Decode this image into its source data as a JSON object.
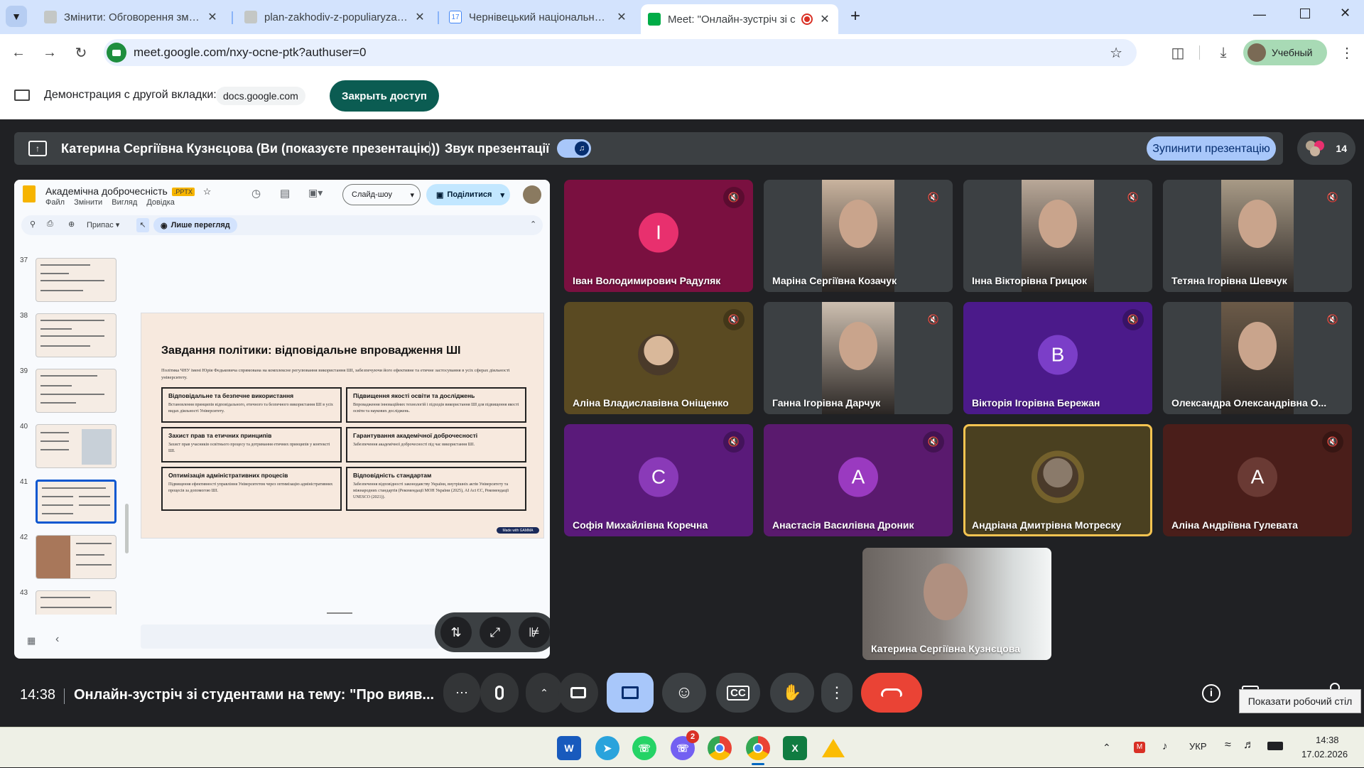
{
  "tabs": [
    {
      "title": "Змінити: Обговорення змін до",
      "active": false
    },
    {
      "title": "plan-zakhodiv-z-populiaryzatsii",
      "active": false
    },
    {
      "title": "Чернівецький національний у",
      "active": false
    },
    {
      "title": "Meet: \"Онлайн-зустріч зі с",
      "active": true
    }
  ],
  "browser": {
    "url": "meet.google.com/nxy-ocne-ptk?authuser=0",
    "profile_label": "Учебный"
  },
  "share_bar": {
    "label": "Демонстрация с другой вкладки:",
    "domain": "docs.google.com",
    "close_button": "Закрыть доступ"
  },
  "presenting_bar": {
    "text": "Катерина Сергіївна Кузнєцова (Ви (показуєте презентацію))",
    "sound_label": "Звук презентації",
    "stop_button": "Зупинити презентацію",
    "participant_count": "14"
  },
  "slides_app": {
    "doc_title": "Академічна доброчесність",
    "badge": ".PPTX",
    "menu": [
      "Файл",
      "Змінити",
      "Вигляд",
      "Довідка"
    ],
    "slideshow_button": "Слайд-шоу",
    "share_button": "Поділитися",
    "zoom_label": "Припас",
    "view_mode": "Лише перегляд",
    "thumbnails": [
      {
        "num": "37",
        "selected": false
      },
      {
        "num": "38",
        "selected": false
      },
      {
        "num": "39",
        "selected": false
      },
      {
        "num": "40",
        "selected": false
      },
      {
        "num": "41",
        "selected": true
      },
      {
        "num": "42",
        "selected": false
      },
      {
        "num": "43",
        "selected": false
      }
    ],
    "slide": {
      "title": "Завдання політики: відповідальне впровадження ШІ",
      "intro": "Політика ЧНУ імені Юрія Федьковича спрямована на комплексне регулювання використання ШІ, забезпечуючи його ефективне та етичне застосування в усіх сферах діяльності університету.",
      "cards": [
        {
          "title": "Відповідальне та безпечне використання",
          "body": "Встановлення принципів відповідального, етичного та безпечного використання ШІ в усіх видах діяльності Університету."
        },
        {
          "title": "Підвищення якості освіти та досліджень",
          "body": "Впровадження інноваційних технологій і підходів використання ШІ для підвищення якості освіти та наукових досліджень."
        },
        {
          "title": "Захист прав та етичних принципів",
          "body": "Захист прав учасників освітнього процесу та дотримання етичних принципів у контексті ШІ."
        },
        {
          "title": "Гарантування академічної доброчесності",
          "body": "Забезпечення академічної доброчесності під час використання ШІ."
        },
        {
          "title": "Оптимізація адміністративних процесів",
          "body": "Підвищення ефективності управління Університетом через оптимізацію адміністративних процесів за допомогою ШІ."
        },
        {
          "title": "Відповідність стандартам",
          "body": "Забезпечення відповідності законодавству України, внутрішніх актів Університету та міжнародних стандартів (Рекомендації МОН України (2025), AI Act ЄС, Рекомендації UNESCO (2021))."
        }
      ],
      "badge": "Made with GAMMA"
    }
  },
  "participants": [
    {
      "name": "Іван Володимирович Радуляк",
      "type": "letter",
      "letter": "І",
      "bg": "#7a1040",
      "circle": "#e8306e",
      "muted": true,
      "video": ""
    },
    {
      "name": "Маріна Сергіївна Козачук",
      "type": "video",
      "bg": "#3c4043",
      "muted": true,
      "video": "#c9b39e"
    },
    {
      "name": "Інна Вікторівна Грицюк",
      "type": "video",
      "bg": "#3c4043",
      "muted": true,
      "video": "#b9a898"
    },
    {
      "name": "Тетяна Ігорівна Шевчук",
      "type": "video",
      "bg": "#3c4043",
      "muted": true,
      "video": "#a89a86"
    },
    {
      "name": "Аліна Владиславівна Оніщенко",
      "type": "avatar",
      "bg": "#5a4a22",
      "muted": true,
      "video": "#d9b89a"
    },
    {
      "name": "Ганна Ігорівна Дарчук",
      "type": "video",
      "bg": "#3c4043",
      "muted": true,
      "video": "#cdbfb0"
    },
    {
      "name": "Вікторія Ігорівна Бережан",
      "type": "letter",
      "letter": "В",
      "bg": "#4b1a8a",
      "circle": "#7b3ec8",
      "muted": true,
      "video": ""
    },
    {
      "name": "Олександра Олександрівна О...",
      "type": "video",
      "bg": "#3c4043",
      "muted": true,
      "video": "#6b5a48"
    },
    {
      "name": "Софія Михайлівна Коречна",
      "type": "letter",
      "letter": "С",
      "bg": "#5a1a7a",
      "circle": "#8a3ab8",
      "muted": true,
      "video": ""
    },
    {
      "name": "Анастасія Василівна Дроник",
      "type": "letter",
      "letter": "А",
      "bg": "#5a1a6e",
      "circle": "#9a3ac0",
      "muted": true,
      "video": ""
    },
    {
      "name": "Андріана Дмитрівна Мотреску",
      "type": "avatar",
      "bg": "#4a4020",
      "muted": false,
      "speaking": true,
      "video": "#8a7a6a"
    },
    {
      "name": "Аліна Андріївна Гулевата",
      "type": "letter",
      "letter": "А",
      "bg": "#4a1e1a",
      "circle": "#6a3a34",
      "muted": true,
      "video": ""
    }
  ],
  "self_tile": {
    "name": "Катерина Сергіївна Кузнєцова"
  },
  "bottom_bar": {
    "time": "14:38",
    "meeting_title": "Онлайн-зустріч зі студентами на тему: \"Про вияв...",
    "tooltip": "Показати робочий стіл"
  },
  "taskbar": {
    "viber_badge": "2",
    "language": "УКР",
    "time": "14:38",
    "date": "17.02.2026"
  },
  "colors": {
    "meet_dark": "#202124",
    "tile_dark": "#3c4043",
    "accent_blue": "#a8c7fa",
    "end_call": "#ea4335",
    "speaking_border": "#f5c451",
    "share_btn": "#0b5c52"
  }
}
